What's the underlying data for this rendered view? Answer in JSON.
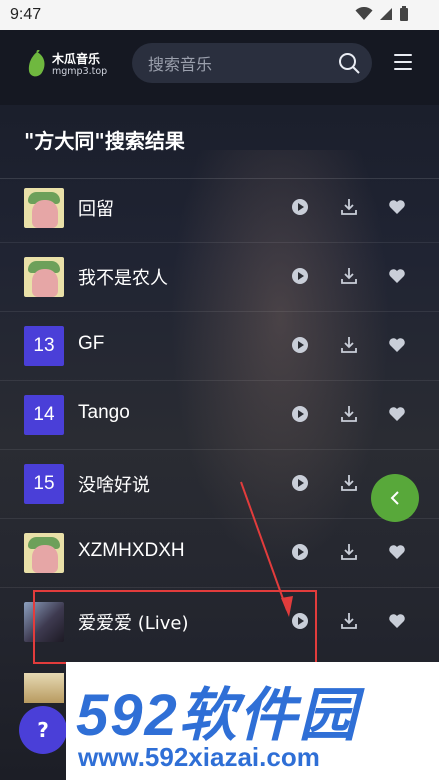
{
  "status_bar": {
    "time": "9:47"
  },
  "header": {
    "logo_title": "木瓜音乐",
    "logo_subtitle": "mgmp3.top",
    "search_placeholder": "搜索音乐"
  },
  "results_title": "\"方大同\"搜索结果",
  "songs": [
    {
      "name": "回留",
      "thumb_type": "art"
    },
    {
      "name": "我不是农人",
      "thumb_type": "art"
    },
    {
      "name": "GF",
      "thumb_type": "number",
      "thumb_label": "13"
    },
    {
      "name": "Tango",
      "thumb_type": "number",
      "thumb_label": "14"
    },
    {
      "name": "没啥好说",
      "thumb_type": "number",
      "thumb_label": "15"
    },
    {
      "name": "XZMHXDXH",
      "thumb_type": "art"
    },
    {
      "name": "爱爱爱 (Live)",
      "thumb_type": "photo"
    }
  ],
  "help_label": "?",
  "watermark": {
    "top": "592软件园",
    "bottom": "www.592xiazai.com"
  },
  "colors": {
    "accent_purple": "#4a3fd8",
    "accent_green": "#58a83a",
    "highlight_red": "#e23c3c",
    "watermark_blue": "#2f6fd6"
  }
}
